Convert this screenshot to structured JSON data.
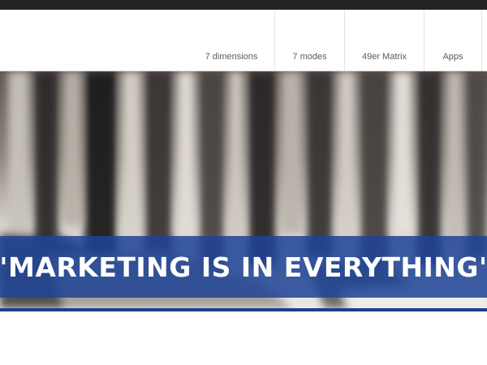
{
  "nav": {
    "items": [
      {
        "label": "7 dimensions"
      },
      {
        "label": "7 modes"
      },
      {
        "label": "49er Matrix"
      },
      {
        "label": "Apps"
      }
    ]
  },
  "hero": {
    "banner_text": "\"MARKETING IS IN EVERYTHING\""
  },
  "colors": {
    "top_bar": "#232323",
    "banner": "#1e4496",
    "accent_line": "#1f3f8a"
  }
}
